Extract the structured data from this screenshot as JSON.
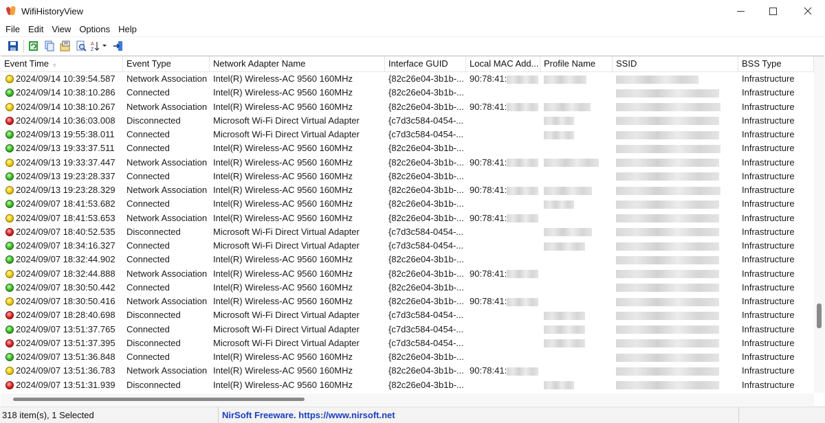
{
  "window": {
    "title": "WifiHistoryView"
  },
  "menu": [
    "File",
    "Edit",
    "View",
    "Options",
    "Help"
  ],
  "toolbar": {
    "buttons": [
      "save-icon",
      "refresh-icon",
      "copy-icon",
      "properties-icon",
      "find-icon",
      "sort-icon",
      "exit-icon"
    ]
  },
  "columns": [
    "Event Time",
    "Event Type",
    "Network Adapter Name",
    "Interface GUID",
    "Local MAC Add...",
    "Profile Name",
    "SSID",
    "BSS Type"
  ],
  "colors": {
    "yellow": "#f3d21a",
    "green": "#3fbf2a",
    "red": "#e0282a",
    "link": "#1b3fbf"
  },
  "rows": [
    {
      "status": "yellow",
      "time": "2024/09/14 10:39:54.587",
      "type": "Network Association",
      "adapter": "Intel(R) Wireless-AC 9560 160MHz",
      "guid": "{82c26e04-3b1b-...",
      "mac": "90:78:41:",
      "bss": "Infrastructure"
    },
    {
      "status": "green",
      "time": "2024/09/14 10:38:10.286",
      "type": "Connected",
      "adapter": "Intel(R) Wireless-AC 9560 160MHz",
      "guid": "{82c26e04-3b1b-...",
      "mac": "",
      "bss": "Infrastructure"
    },
    {
      "status": "yellow",
      "time": "2024/09/14 10:38:10.267",
      "type": "Network Association",
      "adapter": "Intel(R) Wireless-AC 9560 160MHz",
      "guid": "{82c26e04-3b1b-...",
      "mac": "90:78:41:",
      "bss": "Infrastructure"
    },
    {
      "status": "red",
      "time": "2024/09/14 10:36:03.008",
      "type": "Disconnected",
      "adapter": "Microsoft Wi-Fi Direct Virtual Adapter",
      "guid": "{c7d3c584-0454-...",
      "mac": "",
      "bss": "Infrastructure"
    },
    {
      "status": "green",
      "time": "2024/09/13 19:55:38.011",
      "type": "Connected",
      "adapter": "Microsoft Wi-Fi Direct Virtual Adapter",
      "guid": "{c7d3c584-0454-...",
      "mac": "",
      "bss": "Infrastructure"
    },
    {
      "status": "green",
      "time": "2024/09/13 19:33:37.511",
      "type": "Connected",
      "adapter": "Intel(R) Wireless-AC 9560 160MHz",
      "guid": "{82c26e04-3b1b-...",
      "mac": "",
      "bss": "Infrastructure"
    },
    {
      "status": "yellow",
      "time": "2024/09/13 19:33:37.447",
      "type": "Network Association",
      "adapter": "Intel(R) Wireless-AC 9560 160MHz",
      "guid": "{82c26e04-3b1b-...",
      "mac": "90:78:41:",
      "bss": "Infrastructure"
    },
    {
      "status": "green",
      "time": "2024/09/13 19:23:28.337",
      "type": "Connected",
      "adapter": "Intel(R) Wireless-AC 9560 160MHz",
      "guid": "{82c26e04-3b1b-...",
      "mac": "",
      "bss": "Infrastructure"
    },
    {
      "status": "yellow",
      "time": "2024/09/13 19:23:28.329",
      "type": "Network Association",
      "adapter": "Intel(R) Wireless-AC 9560 160MHz",
      "guid": "{82c26e04-3b1b-...",
      "mac": "90:78:41:",
      "bss": "Infrastructure"
    },
    {
      "status": "green",
      "time": "2024/09/07 18:41:53.682",
      "type": "Connected",
      "adapter": "Intel(R) Wireless-AC 9560 160MHz",
      "guid": "{82c26e04-3b1b-...",
      "mac": "",
      "bss": "Infrastructure"
    },
    {
      "status": "yellow",
      "time": "2024/09/07 18:41:53.653",
      "type": "Network Association",
      "adapter": "Intel(R) Wireless-AC 9560 160MHz",
      "guid": "{82c26e04-3b1b-...",
      "mac": "90:78:41:",
      "bss": "Infrastructure"
    },
    {
      "status": "red",
      "time": "2024/09/07 18:40:52.535",
      "type": "Disconnected",
      "adapter": "Microsoft Wi-Fi Direct Virtual Adapter",
      "guid": "{c7d3c584-0454-...",
      "mac": "",
      "bss": "Infrastructure"
    },
    {
      "status": "green",
      "time": "2024/09/07 18:34:16.327",
      "type": "Connected",
      "adapter": "Microsoft Wi-Fi Direct Virtual Adapter",
      "guid": "{c7d3c584-0454-...",
      "mac": "",
      "bss": "Infrastructure"
    },
    {
      "status": "green",
      "time": "2024/09/07 18:32:44.902",
      "type": "Connected",
      "adapter": "Intel(R) Wireless-AC 9560 160MHz",
      "guid": "{82c26e04-3b1b-...",
      "mac": "",
      "bss": "Infrastructure"
    },
    {
      "status": "yellow",
      "time": "2024/09/07 18:32:44.888",
      "type": "Network Association",
      "adapter": "Intel(R) Wireless-AC 9560 160MHz",
      "guid": "{82c26e04-3b1b-...",
      "mac": "90:78:41:",
      "bss": "Infrastructure"
    },
    {
      "status": "green",
      "time": "2024/09/07 18:30:50.442",
      "type": "Connected",
      "adapter": "Intel(R) Wireless-AC 9560 160MHz",
      "guid": "{82c26e04-3b1b-...",
      "mac": "",
      "bss": "Infrastructure"
    },
    {
      "status": "yellow",
      "time": "2024/09/07 18:30:50.416",
      "type": "Network Association",
      "adapter": "Intel(R) Wireless-AC 9560 160MHz",
      "guid": "{82c26e04-3b1b-...",
      "mac": "90:78:41:",
      "bss": "Infrastructure"
    },
    {
      "status": "red",
      "time": "2024/09/07 18:28:40.698",
      "type": "Disconnected",
      "adapter": "Microsoft Wi-Fi Direct Virtual Adapter",
      "guid": "{c7d3c584-0454-...",
      "mac": "",
      "bss": "Infrastructure"
    },
    {
      "status": "green",
      "time": "2024/09/07 13:51:37.765",
      "type": "Connected",
      "adapter": "Microsoft Wi-Fi Direct Virtual Adapter",
      "guid": "{c7d3c584-0454-...",
      "mac": "",
      "bss": "Infrastructure"
    },
    {
      "status": "red",
      "time": "2024/09/07 13:51:37.395",
      "type": "Disconnected",
      "adapter": "Microsoft Wi-Fi Direct Virtual Adapter",
      "guid": "{c7d3c584-0454-...",
      "mac": "",
      "bss": "Infrastructure"
    },
    {
      "status": "green",
      "time": "2024/09/07 13:51:36.848",
      "type": "Connected",
      "adapter": "Intel(R) Wireless-AC 9560 160MHz",
      "guid": "{82c26e04-3b1b-...",
      "mac": "",
      "bss": "Infrastructure"
    },
    {
      "status": "yellow",
      "time": "2024/09/07 13:51:36.783",
      "type": "Network Association",
      "adapter": "Intel(R) Wireless-AC 9560 160MHz",
      "guid": "{82c26e04-3b1b-...",
      "mac": "90:78:41:",
      "bss": "Infrastructure"
    },
    {
      "status": "red",
      "time": "2024/09/07 13:51:31.939",
      "type": "Disconnected",
      "adapter": "Intel(R) Wireless-AC 9560 160MHz",
      "guid": "{82c26e04-3b1b-...",
      "mac": "",
      "bss": "Infrastructure"
    }
  ],
  "status": {
    "count": "318 item(s), 1 Selected",
    "link": "NirSoft Freeware. https://www.nirsoft.net"
  }
}
